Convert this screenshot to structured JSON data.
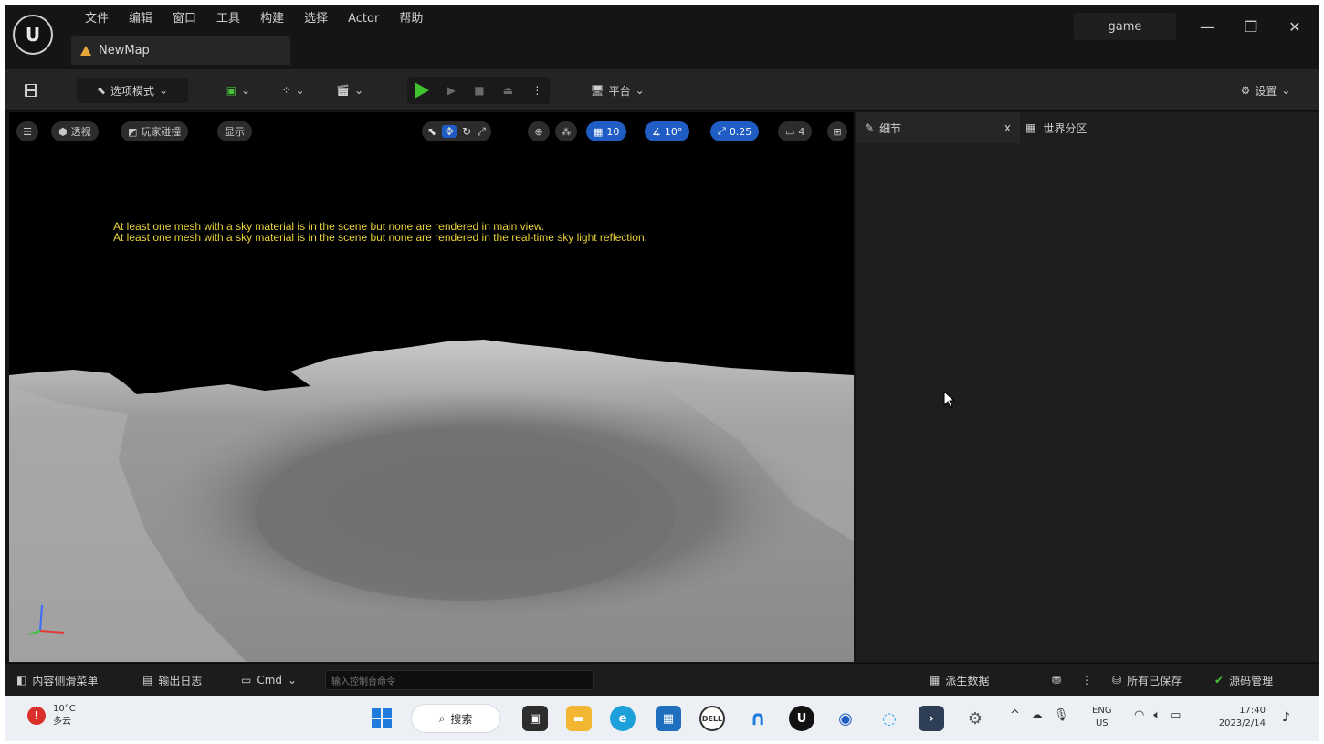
{
  "window": {
    "menu": [
      "文件",
      "编辑",
      "窗口",
      "工具",
      "构建",
      "选择",
      "Actor",
      "帮助"
    ],
    "map_tab": "NewMap",
    "project_name": "game",
    "controls": {
      "minimize": "—",
      "restore": "❐",
      "close": "✕"
    }
  },
  "toolbar": {
    "mode_label": "选项模式",
    "platforms_label": "平台",
    "settings_label": "设置"
  },
  "viewport": {
    "perspective_label": "透视",
    "lit_label": "玩家碰撞",
    "show_label": "显示",
    "grid_snap": "10",
    "rotation_snap": "10°",
    "scale_snap": "0.25",
    "camera_speed": "4",
    "warnings": [
      "At least one mesh with a sky material is in the scene but none are rendered in main view.",
      "At least one mesh with a sky material is in the scene but none are rendered in the real-time sky light reflection."
    ]
  },
  "details": {
    "tab_label": "细节",
    "close_label": "x",
    "world_partition_label": "世界分区"
  },
  "statusbar": {
    "content_drawer": "内容侧滑菜单",
    "output_log": "输出日志",
    "cmd_label": "Cmd",
    "cmd_placeholder": "输入控制台命令",
    "derived_data": "派生数据",
    "all_saved": "所有已保存",
    "source_control": "源码管理"
  },
  "taskbar": {
    "weather_temp": "10°C",
    "weather_desc": "多云",
    "search_label": "搜索",
    "lang_top": "ENG",
    "lang_bottom": "US",
    "time": "17:40",
    "date": "2023/2/14"
  },
  "colors": {
    "play_green": "#3fc42f",
    "accent_blue": "#1f5cc4",
    "warning_yellow": "#e8d23a",
    "map_icon_orange": "#e7a63a"
  }
}
